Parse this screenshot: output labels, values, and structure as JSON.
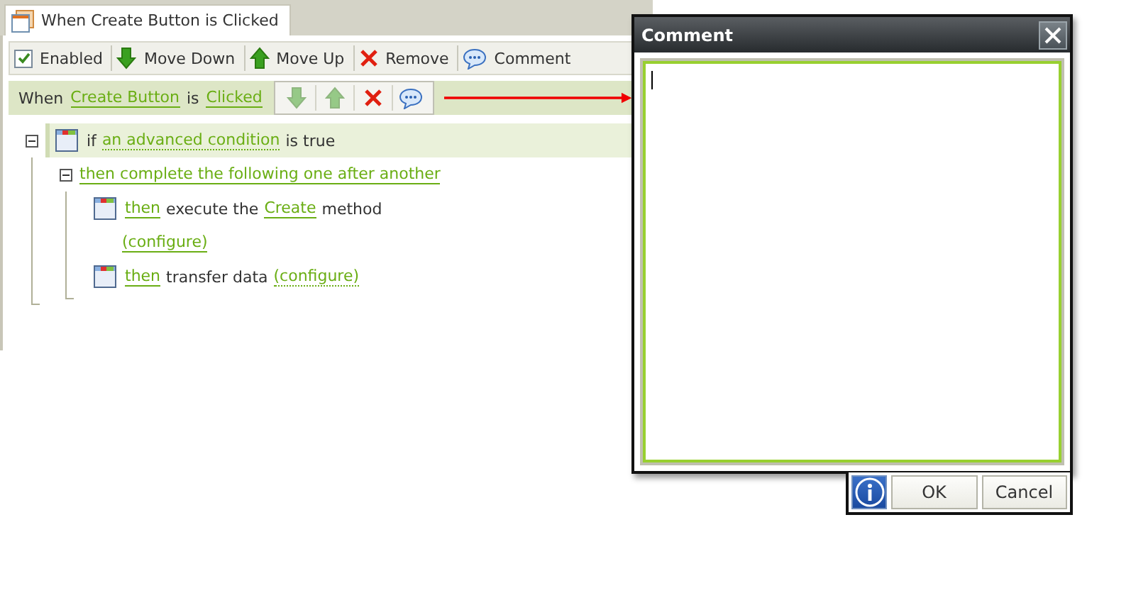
{
  "tab": {
    "title": "When Create Button is Clicked",
    "selected": true
  },
  "toolbar": {
    "enabled": {
      "label": "Enabled",
      "checked": true
    },
    "buttons": [
      {
        "kind": "down",
        "label": "Move Down"
      },
      {
        "kind": "up",
        "label": "Move Up"
      },
      {
        "kind": "remove",
        "label": "Remove"
      },
      {
        "kind": "comment",
        "label": "Comment"
      }
    ]
  },
  "rule": {
    "segments": [
      {
        "kind": "text",
        "text": "When"
      },
      {
        "kind": "link",
        "text": "Create Button"
      },
      {
        "kind": "text",
        "text": "is"
      },
      {
        "kind": "link",
        "text": "Clicked"
      }
    ],
    "actions": [
      {
        "kind": "down",
        "disabled": true
      },
      {
        "kind": "up",
        "disabled": true
      },
      {
        "kind": "remove",
        "disabled": false
      },
      {
        "kind": "comment",
        "disabled": false
      }
    ]
  },
  "tree": [
    {
      "expanded": true,
      "icon": true,
      "selected": true,
      "lines": [
        [
          {
            "kind": "text",
            "text": "if"
          },
          {
            "kind": "dotted",
            "text": "an advanced condition"
          },
          {
            "kind": "text",
            "text": "is true"
          }
        ]
      ],
      "children": [
        {
          "expanded": true,
          "icon": false,
          "selected": false,
          "lines": [
            [
              {
                "kind": "link",
                "text": "then complete the following one after another"
              }
            ]
          ],
          "children": [
            {
              "icon": true,
              "selected": false,
              "lines": [
                [
                  {
                    "kind": "link",
                    "text": "then"
                  },
                  {
                    "kind": "text",
                    "text": "execute the"
                  },
                  {
                    "kind": "link",
                    "text": "Create"
                  },
                  {
                    "kind": "text",
                    "text": "method"
                  }
                ],
                [
                  {
                    "kind": "link",
                    "text": "(configure)"
                  }
                ]
              ]
            },
            {
              "icon": true,
              "selected": false,
              "lines": [
                [
                  {
                    "kind": "link",
                    "text": "then"
                  },
                  {
                    "kind": "text",
                    "text": "transfer data"
                  },
                  {
                    "kind": "dotted",
                    "text": "(configure)"
                  }
                ]
              ]
            }
          ]
        }
      ]
    }
  ],
  "dialog": {
    "title": "Comment",
    "comment": {
      "focused": true
    },
    "buttons": [
      "OK",
      "Cancel"
    ]
  }
}
